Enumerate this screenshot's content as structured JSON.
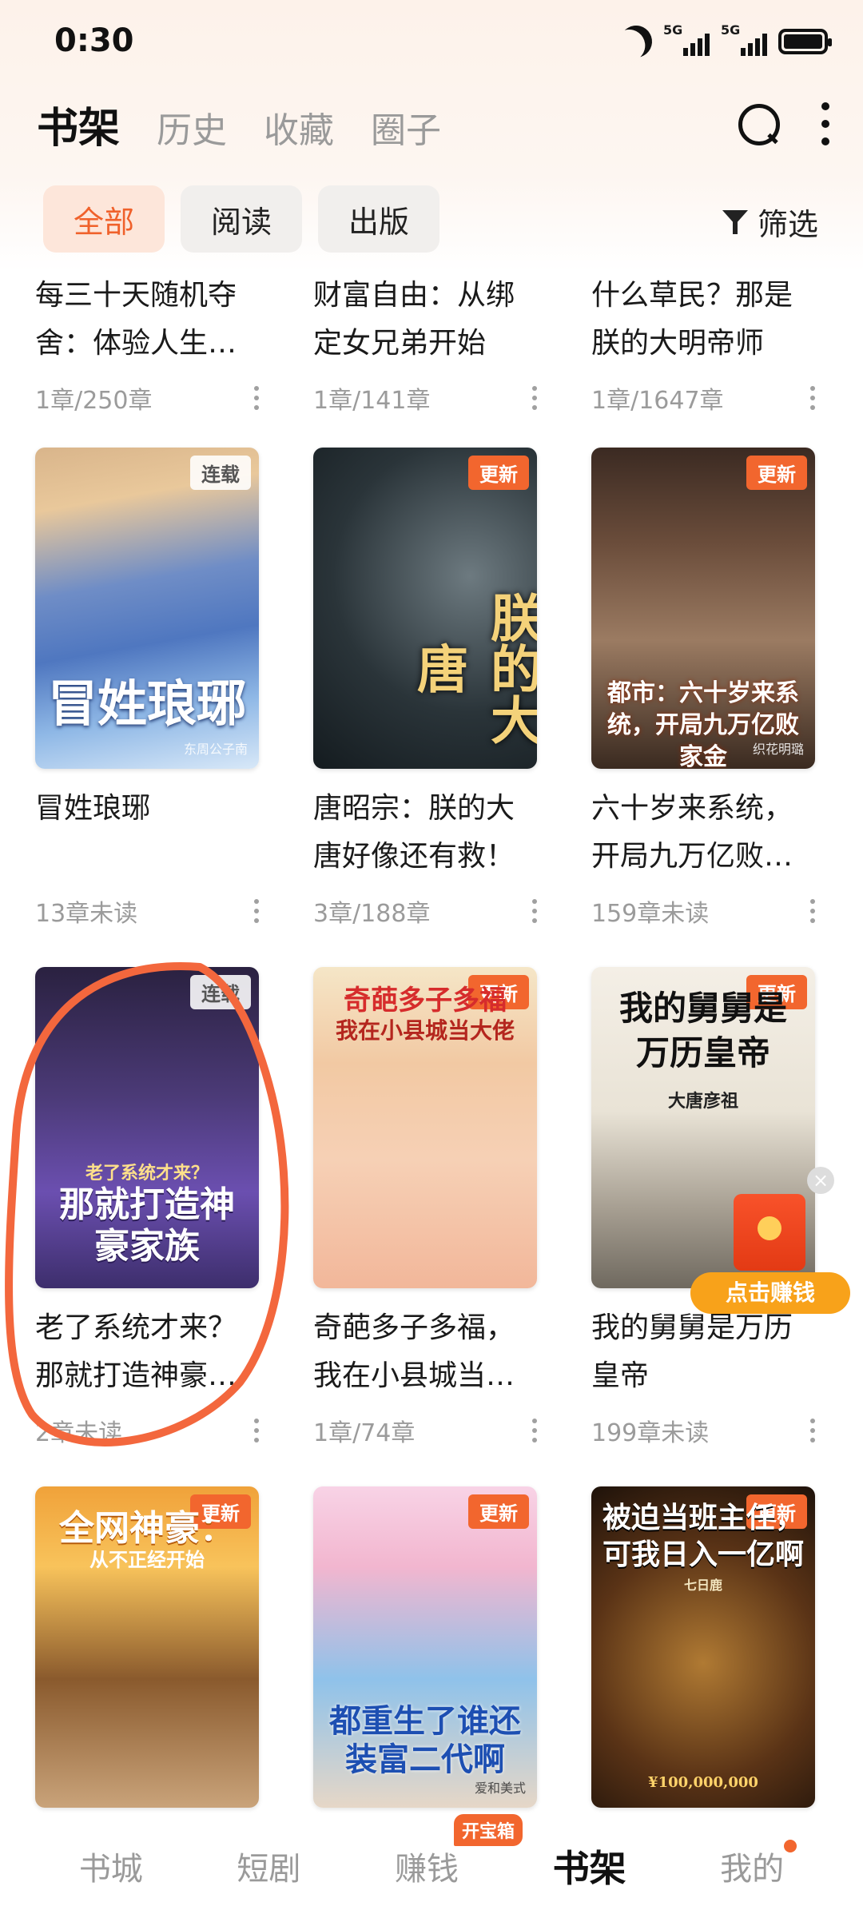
{
  "status_bar": {
    "time": "0:30",
    "sig1": "5G",
    "sig2": "5G"
  },
  "header": {
    "tabs": [
      {
        "label": "书架",
        "active": true
      },
      {
        "label": "历史",
        "active": false
      },
      {
        "label": "收藏",
        "active": false
      },
      {
        "label": "圈子",
        "active": false
      }
    ]
  },
  "filters": {
    "chips": [
      {
        "label": "全部",
        "active": true
      },
      {
        "label": "阅读",
        "active": false
      },
      {
        "label": "出版",
        "active": false
      }
    ],
    "filter_label": "筛选"
  },
  "books": [
    {
      "title": "每三十天随机夺舍：体验人生…",
      "meta": "1章/250章"
    },
    {
      "title": "财富自由：从绑定女兄弟开始",
      "meta": "1章/141章"
    },
    {
      "title": "什么草民？那是朕的大明帝师",
      "meta": "1章/1647章"
    },
    {
      "title": "冒姓琅琊",
      "meta": "13章未读",
      "badge": "连载",
      "cover_text": "冒姓琅琊",
      "author": "东周公子南"
    },
    {
      "title": "唐昭宗：朕的大唐好像还有救！",
      "meta": "3章/188章",
      "badge": "更新",
      "cover_text": "朕的大唐"
    },
    {
      "title": "六十岁来系统，开局九万亿败…",
      "meta": "159章未读",
      "badge": "更新",
      "cover_text": "都市：六十岁来系统，开局九万亿败家金",
      "author": "织花明璐"
    },
    {
      "title": "老了系统才来？那就打造神豪…",
      "meta": "2章未读",
      "badge": "连载",
      "cover_text": "那就打造神豪家族",
      "cover_sub": "老了系统才来？"
    },
    {
      "title": "奇葩多子多福，我在小县城当…",
      "meta": "1章/74章",
      "badge": "更新",
      "cover_text": "奇葩多子多福",
      "cover_sub": "我在小县城当大佬"
    },
    {
      "title": "我的舅舅是万历皇帝",
      "meta": "199章未读",
      "badge": "更新",
      "cover_text": "我的舅舅是万历皇帝",
      "author": "大唐彦祖"
    },
    {
      "badge": "更新",
      "cover_text": "全网神豪：",
      "cover_sub": "从不正经开始"
    },
    {
      "badge": "更新",
      "cover_text": "都重生了谁还装富二代啊",
      "author": "爱和美式"
    },
    {
      "badge": "更新",
      "cover_text": "被迫当班主任，可我日入一亿啊",
      "author": "七日鹿",
      "cover_sub": "¥100,000,000"
    }
  ],
  "floating": {
    "label": "点击赚钱"
  },
  "bottom_nav": {
    "items": [
      {
        "label": "书城",
        "active": false
      },
      {
        "label": "短剧",
        "active": false
      },
      {
        "label": "赚钱",
        "active": false,
        "badge": "开宝箱"
      },
      {
        "label": "书架",
        "active": true
      },
      {
        "label": "我的",
        "active": false,
        "dot": true
      }
    ]
  },
  "colors": {
    "accent": "#f2662e",
    "annotation": "#f3673d"
  }
}
